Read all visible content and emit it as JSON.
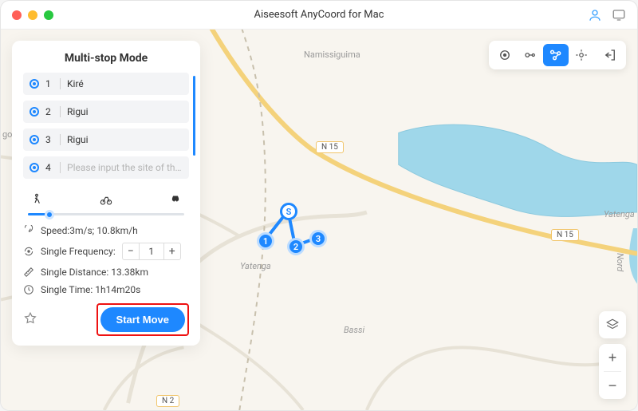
{
  "app": {
    "title": "Aiseesoft AnyCoord for Mac"
  },
  "panel": {
    "title": "Multi-stop Mode",
    "stops": [
      {
        "num": "1",
        "name": "Kiré"
      },
      {
        "num": "2",
        "name": "Rigui"
      },
      {
        "num": "3",
        "name": "Rigui"
      }
    ],
    "input_stop": {
      "num": "4",
      "placeholder": "Please input the site of this pat"
    },
    "speed_label": "Speed:3m/s; 10.8km/h",
    "frequency_label": "Single Frequency:",
    "frequency_value": "1",
    "distance_label": "Single Distance: 13.38km",
    "time_label": "Single Time: 1h14m20s",
    "start_button": "Start Move"
  },
  "map": {
    "labels": {
      "namissiguima": "Namissiguima",
      "yatenga1": "Yatenga",
      "yatenga2": "Yatenga",
      "bassi": "Bassi",
      "gore": "gore",
      "nord": "Nord"
    },
    "road_badges": {
      "n15a": "N 15",
      "n15b": "N 15",
      "n2": "N 2"
    },
    "colors": {
      "accent": "#1e88ff",
      "water": "#9fd7ea",
      "land": "#f8f5ef"
    }
  },
  "symbols": {
    "minus": "−",
    "plus": "+"
  }
}
